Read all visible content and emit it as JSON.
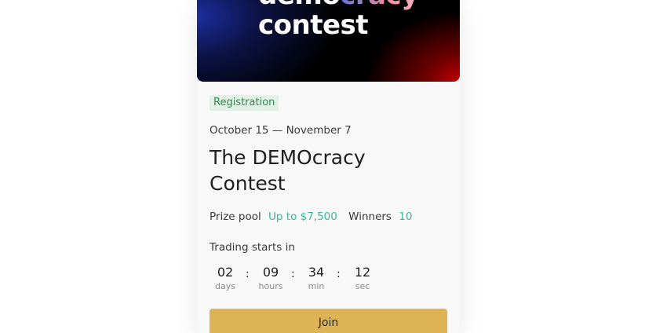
{
  "banner": {
    "line1_start": "demo",
    "line1_flag": "cracy",
    "line2": "contest"
  },
  "badge": "Registration",
  "dates": "October 15 — November 7",
  "title": "The DEMOcracy Contest",
  "prize": {
    "label": "Prize pool",
    "value": "Up to $7,500"
  },
  "winners": {
    "label": "Winners",
    "value": "10"
  },
  "countdown": {
    "label": "Trading starts in",
    "separator": ":",
    "days": {
      "value": "02",
      "unit": "days"
    },
    "hours": {
      "value": "09",
      "unit": "hours"
    },
    "minutes": {
      "value": "34",
      "unit": "min"
    },
    "seconds": {
      "value": "12",
      "unit": "sec"
    }
  },
  "join_label": "Join",
  "colors": {
    "accent": "#39b79c",
    "badge_bg": "#e2f0e6",
    "badge_text": "#2f8a55",
    "button": "#ddb354"
  }
}
